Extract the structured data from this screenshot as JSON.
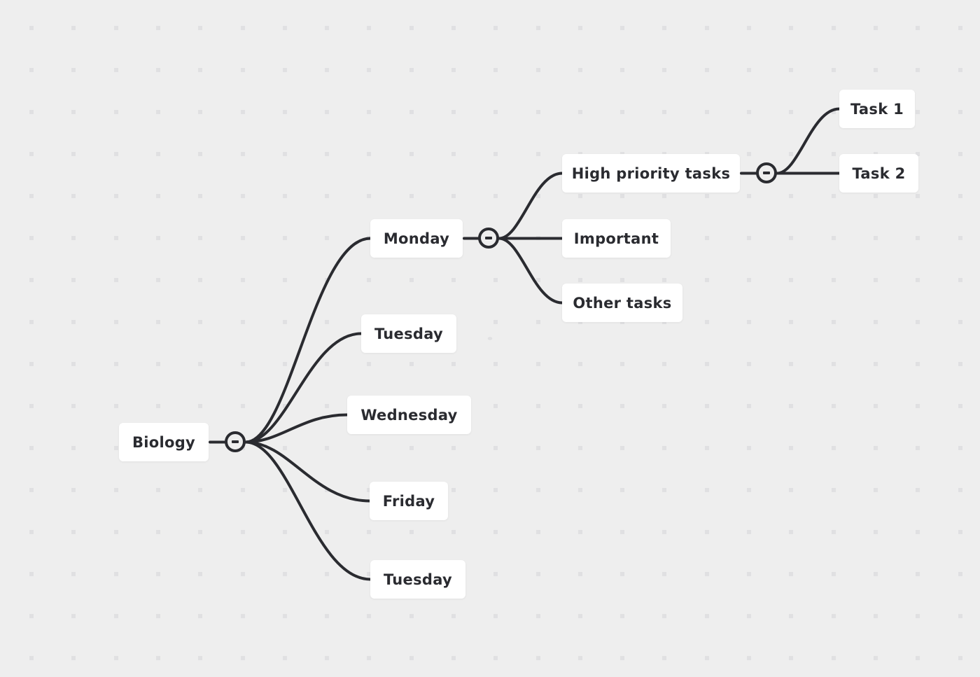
{
  "canvas": {
    "background": "#eeeeee",
    "dot_color": "#e0e0e2",
    "line_color": "#2a2b30"
  },
  "mindmap": {
    "root": {
      "label": "Biology",
      "collapsed": false,
      "children": [
        {
          "label": "Monday",
          "collapsed": false,
          "children": [
            {
              "label": "High priority tasks",
              "collapsed": false,
              "children": [
                {
                  "label": "Task 1"
                },
                {
                  "label": "Task 2"
                }
              ]
            },
            {
              "label": "Important"
            },
            {
              "label": "Other tasks"
            }
          ]
        },
        {
          "label": "Tuesday"
        },
        {
          "label": "Wednesday"
        },
        {
          "label": "Friday"
        },
        {
          "label": "Tuesday"
        }
      ]
    }
  },
  "toggles": {
    "icon": "collapse-minus-icon"
  }
}
